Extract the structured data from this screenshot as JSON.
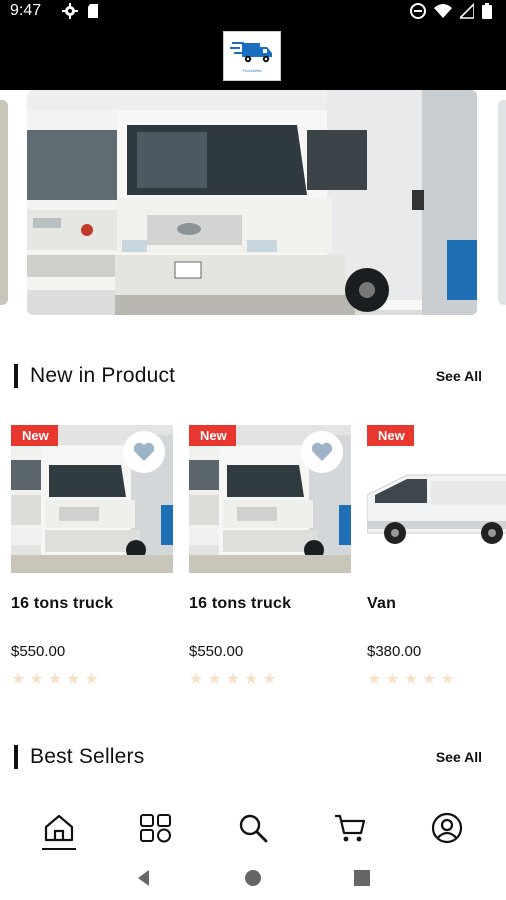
{
  "status_bar": {
    "time": "9:47",
    "icons": [
      "gear-icon",
      "sd-card-icon",
      "dnd-icon",
      "wifi-icon",
      "signal-icon",
      "battery-icon"
    ]
  },
  "app_bar": {
    "logo_icon": "truck-logo-icon",
    "logo_text": "TruckWeb"
  },
  "carousel": {
    "slides": [
      "truck-photo"
    ]
  },
  "new_products": {
    "title": "New in Product",
    "see_all": "See All",
    "items": [
      {
        "badge": "New",
        "name": "16 tons truck",
        "price": "$550.00",
        "rating": 0
      },
      {
        "badge": "New",
        "name": "16 tons truck",
        "price": "$550.00",
        "rating": 0
      },
      {
        "badge": "New",
        "name": "Van",
        "price": "$380.00",
        "rating": 0
      }
    ]
  },
  "best_sellers": {
    "title": "Best Sellers",
    "see_all": "See All"
  },
  "bottom_nav": {
    "items": [
      "home-icon",
      "categories-icon",
      "search-icon",
      "cart-icon",
      "profile-icon"
    ],
    "active": "home-icon"
  },
  "colors": {
    "badge": "#e8372e",
    "star_empty": "#f6e2c8",
    "heart": "#9fb3c8",
    "logo_blue": "#1b6fc0"
  }
}
